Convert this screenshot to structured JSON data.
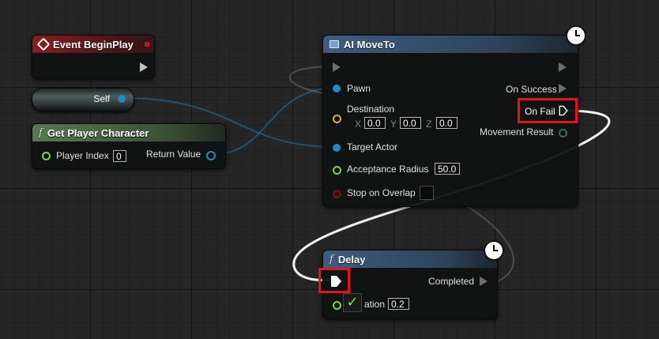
{
  "nodes": {
    "event_begin_play": {
      "title": "Event BeginPlay"
    },
    "self": {
      "label": "Self"
    },
    "get_player_character": {
      "title": "Get Player Character",
      "player_index_label": "Player Index",
      "player_index_value": "0",
      "return_value_label": "Return Value"
    },
    "ai_move_to": {
      "title": "AI MoveTo",
      "pawn_label": "Pawn",
      "destination_label": "Destination",
      "x_label": "X",
      "x_value": "0.0",
      "y_label": "Y",
      "y_value": "0.0",
      "z_label": "Z",
      "z_value": "0.0",
      "target_actor_label": "Target Actor",
      "acceptance_radius_label": "Acceptance Radius",
      "acceptance_radius_value": "50.0",
      "stop_on_overlap_label": "Stop on Overlap",
      "on_success_label": "On Success",
      "on_fail_label": "On Fail",
      "movement_result_label": "Movement Result"
    },
    "delay": {
      "title": "Delay",
      "completed_label": "Completed",
      "duration_label": "ation",
      "duration_value": "0.2"
    }
  },
  "colors": {
    "highlight": "#e8121c",
    "exec_wire": "#ffffff",
    "object_wire": "#1e8ac8",
    "event_header": "#8c1d1d",
    "pure_function_header": "#557a4f",
    "function_header": "#3d5d82"
  },
  "icons": {
    "event": "diamond-event-icon",
    "function": "f-function-icon",
    "latent": "clock-icon",
    "checkmark": "checkmark-icon"
  }
}
